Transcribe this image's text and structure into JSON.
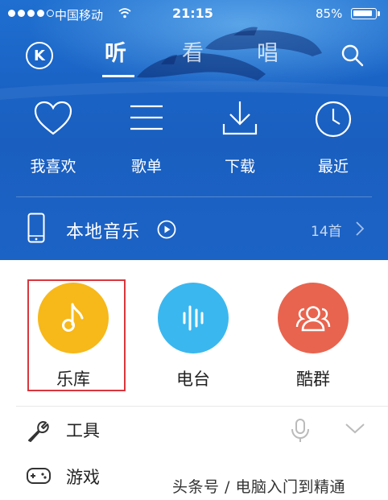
{
  "status": {
    "carrier": "中国移动",
    "time": "21:15",
    "battery_pct": "85%",
    "battery_level": 0.85
  },
  "nav": {
    "logo_letter": "K",
    "tabs": [
      "听",
      "看",
      "唱"
    ],
    "active_tab": "听"
  },
  "quick_actions": [
    {
      "label": "我喜欢",
      "icon": "heart-icon"
    },
    {
      "label": "歌单",
      "icon": "list-icon"
    },
    {
      "label": "下载",
      "icon": "download-icon"
    },
    {
      "label": "最近",
      "icon": "clock-icon"
    }
  ],
  "local_music": {
    "label": "本地音乐",
    "count": "14首"
  },
  "categories": [
    {
      "label": "乐库",
      "color": "#f7b819",
      "icon": "music-note-icon"
    },
    {
      "label": "电台",
      "color": "#3bb7ef",
      "icon": "radio-bars-icon"
    },
    {
      "label": "酷群",
      "color": "#e8644f",
      "icon": "group-icon"
    }
  ],
  "list": [
    {
      "label": "工具",
      "icon": "wrench-icon"
    },
    {
      "label": "游戏",
      "icon": "gamepad-icon"
    }
  ],
  "watermark": "头条号 / 电脑入门到精通",
  "colors": {
    "hero_blue": "#1a64c6",
    "highlight_red": "#d9363e"
  }
}
